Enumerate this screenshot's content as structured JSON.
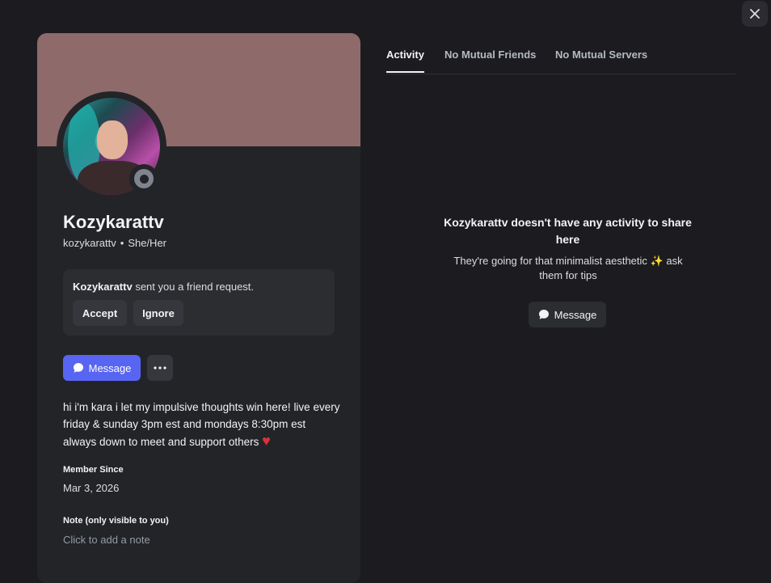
{
  "colors": {
    "banner": "#8f6a6a",
    "accent": "#5865f2",
    "background": "#1c1c20",
    "card": "#232428"
  },
  "profile": {
    "display_name": "Kozykarattv",
    "username": "kozykarattv",
    "separator": "•",
    "pronouns": "She/Her",
    "status": "offline"
  },
  "friend_request": {
    "name": "Kozykarattv",
    "text": "sent you a friend request.",
    "accept_label": "Accept",
    "ignore_label": "Ignore"
  },
  "actions": {
    "message_label": "Message",
    "more_icon": "ellipsis-icon"
  },
  "bio": {
    "text": "hi i'm kara i let my impulsive thoughts win here! live every friday & sunday 3pm est and mondays 8:30pm est always down to meet and support others",
    "emoji": "♥"
  },
  "member_since": {
    "label": "Member Since",
    "value": "Mar 3, 2026"
  },
  "note": {
    "label": "Note (only visible to you)",
    "placeholder": "Click to add a note"
  },
  "tabs": [
    {
      "label": "Activity",
      "active": true
    },
    {
      "label": "No Mutual Friends",
      "active": false
    },
    {
      "label": "No Mutual Servers",
      "active": false
    }
  ],
  "activity_empty": {
    "title": "Kozykarattv doesn't have any activity to share here",
    "subtitle": "They're going for that minimalist aesthetic",
    "sparkle": "✨",
    "subtitle_end": "ask them for tips",
    "message_label": "Message"
  }
}
